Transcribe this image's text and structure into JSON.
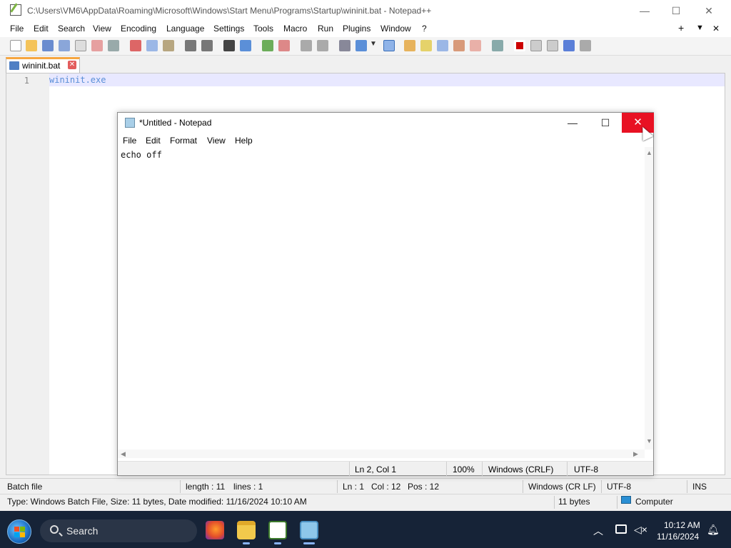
{
  "npp": {
    "title": "C:\\Users\\VM6\\AppData\\Roaming\\Microsoft\\Windows\\Start Menu\\Programs\\Startup\\wininit.bat - Notepad++",
    "menu": [
      "File",
      "Edit",
      "Search",
      "View",
      "Encoding",
      "Language",
      "Settings",
      "Tools",
      "Macro",
      "Run",
      "Plugins",
      "Window",
      "?"
    ],
    "menu_right": {
      "plus": "+",
      "down": "▼",
      "close": "✕"
    },
    "tab_label": "wininit.bat",
    "tab_close": "✕",
    "line_number": "1",
    "code": "wininit.exe",
    "status": {
      "type": "Batch file",
      "length": "length : 11",
      "lines": "lines : 1",
      "ln": "Ln : 1",
      "col": "Col : 12",
      "pos": "Pos : 12",
      "eol": "Windows (CR LF)",
      "enc": "UTF-8",
      "ins": "INS"
    },
    "window_controls": {
      "minimize": "—",
      "maximize": "☐",
      "close": "✕"
    }
  },
  "explorer_status": {
    "info": "Type: Windows Batch File, Size: 11 bytes, Date modified: 11/16/2024 10:10 AM",
    "size": "11 bytes",
    "location": "Computer"
  },
  "notepad": {
    "title": "*Untitled - Notepad",
    "menu": [
      "File",
      "Edit",
      "Format",
      "View",
      "Help"
    ],
    "content": "echo off",
    "controls": {
      "minimize": "—",
      "maximize": "☐",
      "close": "✕"
    },
    "status": {
      "pos": "Ln 2, Col 1",
      "zoom": "100%",
      "eol": "Windows (CRLF)",
      "enc": "UTF-8"
    }
  },
  "taskbar": {
    "search_label": "Search",
    "time": "10:12 AM",
    "date": "11/16/2024",
    "icons": [
      "start-icon",
      "firefox-icon",
      "file-explorer-icon",
      "notepadpp-icon",
      "notepad-icon"
    ]
  }
}
